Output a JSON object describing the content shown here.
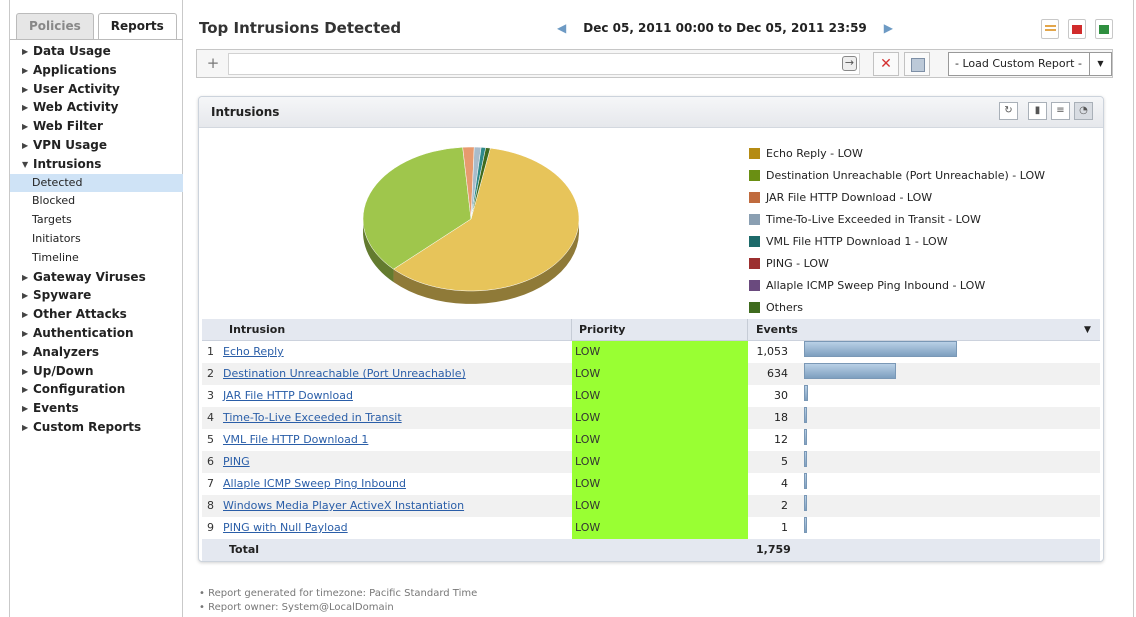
{
  "sidebar": {
    "tabs": [
      {
        "label": "Policies"
      },
      {
        "label": "Reports"
      }
    ],
    "items": [
      {
        "label": "Data Usage"
      },
      {
        "label": "Applications"
      },
      {
        "label": "User Activity"
      },
      {
        "label": "Web Activity"
      },
      {
        "label": "Web Filter"
      },
      {
        "label": "VPN Usage"
      },
      {
        "label": "Intrusions"
      },
      {
        "label": "Gateway Viruses"
      },
      {
        "label": "Spyware"
      },
      {
        "label": "Other Attacks"
      },
      {
        "label": "Authentication"
      },
      {
        "label": "Analyzers"
      },
      {
        "label": "Up/Down"
      },
      {
        "label": "Configuration"
      },
      {
        "label": "Events"
      },
      {
        "label": "Custom Reports"
      }
    ],
    "intrusions_sub": [
      {
        "label": "Detected",
        "selected": true
      },
      {
        "label": "Blocked"
      },
      {
        "label": "Targets"
      },
      {
        "label": "Initiators"
      },
      {
        "label": "Timeline"
      }
    ]
  },
  "header": {
    "title": "Top Intrusions Detected",
    "date_range": "Dec 05, 2011 00:00 to Dec 05, 2011 23:59"
  },
  "filter": {
    "load_report_label": "- Load Custom Report -"
  },
  "panel": {
    "title": "Intrusions"
  },
  "legend": [
    {
      "label": "Echo Reply - LOW",
      "color": "#b58b13"
    },
    {
      "label": "Destination Unreachable (Port Unreachable) - LOW",
      "color": "#6a8f13"
    },
    {
      "label": "JAR File HTTP Download - LOW",
      "color": "#c06b3e"
    },
    {
      "label": "Time-To-Live Exceeded in Transit - LOW",
      "color": "#8a9fb2"
    },
    {
      "label": "VML File HTTP Download 1 - LOW",
      "color": "#1d6a6a"
    },
    {
      "label": "PING - LOW",
      "color": "#9c2f2f"
    },
    {
      "label": "Allaple ICMP Sweep Ping Inbound - LOW",
      "color": "#6a4a7e"
    },
    {
      "label": "Others",
      "color": "#3f6b1e"
    }
  ],
  "table": {
    "headers": {
      "name": "Intrusion",
      "priority": "Priority",
      "events": "Events"
    },
    "rows": [
      {
        "num": "1",
        "name": "Echo Reply",
        "priority": "LOW",
        "events": "1,053",
        "value": 1053
      },
      {
        "num": "2",
        "name": "Destination Unreachable (Port Unreachable)",
        "priority": "LOW",
        "events": "634",
        "value": 634
      },
      {
        "num": "3",
        "name": "JAR File HTTP Download",
        "priority": "LOW",
        "events": "30",
        "value": 30
      },
      {
        "num": "4",
        "name": "Time-To-Live Exceeded in Transit",
        "priority": "LOW",
        "events": "18",
        "value": 18
      },
      {
        "num": "5",
        "name": "VML File HTTP Download 1",
        "priority": "LOW",
        "events": "12",
        "value": 12
      },
      {
        "num": "6",
        "name": "PING",
        "priority": "LOW",
        "events": "5",
        "value": 5
      },
      {
        "num": "7",
        "name": "Allaple ICMP Sweep Ping Inbound",
        "priority": "LOW",
        "events": "4",
        "value": 4
      },
      {
        "num": "8",
        "name": "Windows Media Player ActiveX Instantiation",
        "priority": "LOW",
        "events": "2",
        "value": 2
      },
      {
        "num": "9",
        "name": "PING with Null Payload",
        "priority": "LOW",
        "events": "1",
        "value": 1
      }
    ],
    "total_label": "Total",
    "total_value": "1,759"
  },
  "chart_data": {
    "type": "pie",
    "categories": [
      "Echo Reply",
      "Destination Unreachable (Port Unreachable)",
      "JAR File HTTP Download",
      "Time-To-Live Exceeded in Transit",
      "VML File HTTP Download 1",
      "Others"
    ],
    "values": [
      1053,
      634,
      30,
      18,
      12,
      12
    ],
    "colors": [
      "#e7c45a",
      "#9fc64c",
      "#e79a6e",
      "#a9bccb",
      "#2f8a8a",
      "#3f6b1e"
    ]
  },
  "footnotes": [
    "Report generated for timezone: Pacific Standard Time",
    "Report owner: System@LocalDomain"
  ]
}
